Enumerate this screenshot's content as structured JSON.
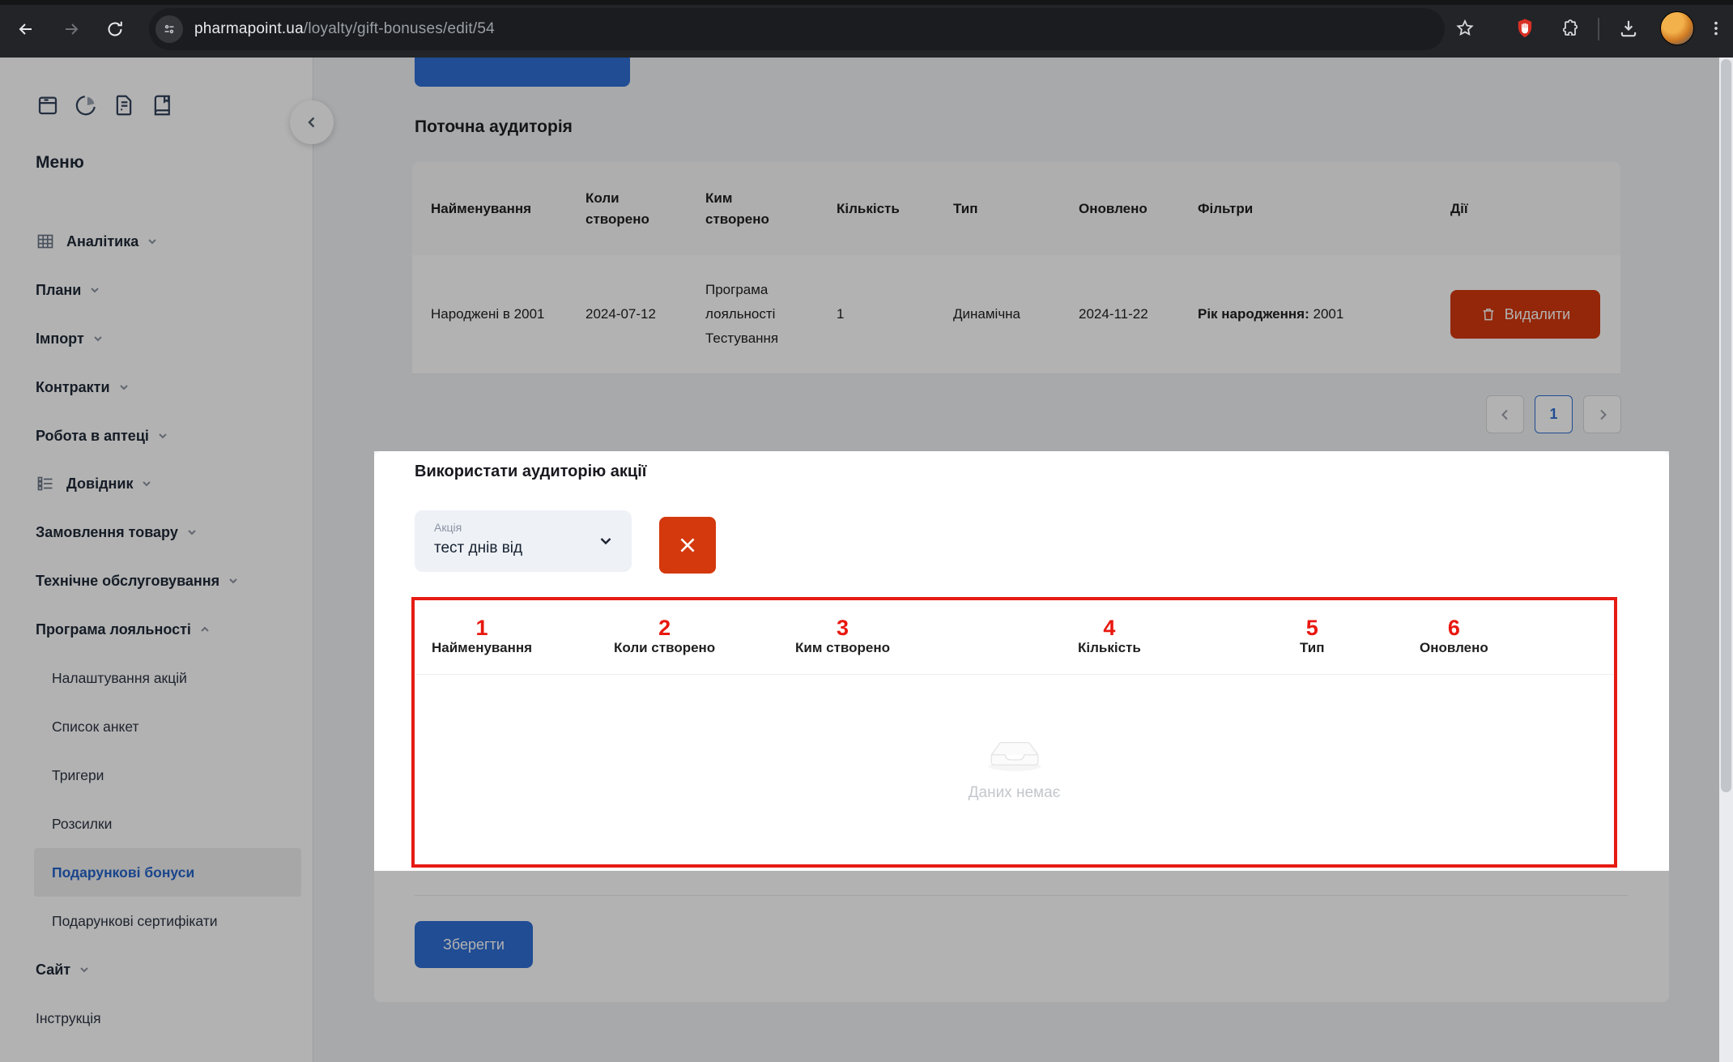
{
  "browser": {
    "url_host": "pharmapoint.ua",
    "url_path": "/loyalty/gift-bonuses/edit/54"
  },
  "sidebar": {
    "menu_title": "Меню",
    "items": [
      {
        "label": "Аналітика"
      },
      {
        "label": "Плани"
      },
      {
        "label": "Імпорт"
      },
      {
        "label": "Контракти"
      },
      {
        "label": "Робота в аптеці"
      },
      {
        "label": "Довідник"
      },
      {
        "label": "Замовлення товару"
      },
      {
        "label": "Технічне обслуговування"
      },
      {
        "label": "Програма лояльності"
      }
    ],
    "loyalty_submenu": [
      {
        "label": "Налаштування акцій"
      },
      {
        "label": "Список анкет"
      },
      {
        "label": "Тригери"
      },
      {
        "label": "Розсилки"
      },
      {
        "label": "Подарункові бонуси"
      },
      {
        "label": "Подарункові сертифікати"
      }
    ],
    "active_submenu_item": "Подарункові бонуси",
    "site_item": "Сайт",
    "instruction_item": "Інструкція"
  },
  "current_audience": {
    "title": "Поточна аудиторія",
    "columns": [
      "Найменування",
      "Коли створено",
      "Ким створено",
      "Кількість",
      "Тип",
      "Оновлено",
      "Фільтри",
      "Дії"
    ],
    "row": {
      "name": "Народжені в 2001",
      "created_at": "2024-07-12",
      "created_by": "Програма лояльності Тестування",
      "count": "1",
      "type": "Динамічна",
      "updated_at": "2024-11-22",
      "filter_label": "Рік народження:",
      "filter_value": "2001",
      "delete_label": "Видалити"
    },
    "pagination": {
      "current_page": "1"
    }
  },
  "use_audience": {
    "title": "Використати аудиторію акції",
    "select_label": "Акція",
    "select_value": "тест днів від",
    "columns": [
      {
        "num": "1",
        "label": "Найменування"
      },
      {
        "num": "2",
        "label": "Коли створено"
      },
      {
        "num": "3",
        "label": "Ким створено"
      },
      {
        "num": "4",
        "label": "Кількість"
      },
      {
        "num": "5",
        "label": "Тип"
      },
      {
        "num": "6",
        "label": "Оновлено"
      }
    ],
    "empty_text": "Даних немає",
    "save_label": "Зберегти"
  },
  "colors": {
    "accent_blue": "#2e6fd4",
    "danger_red": "#d4380d",
    "annotation_red": "#e8180f"
  }
}
